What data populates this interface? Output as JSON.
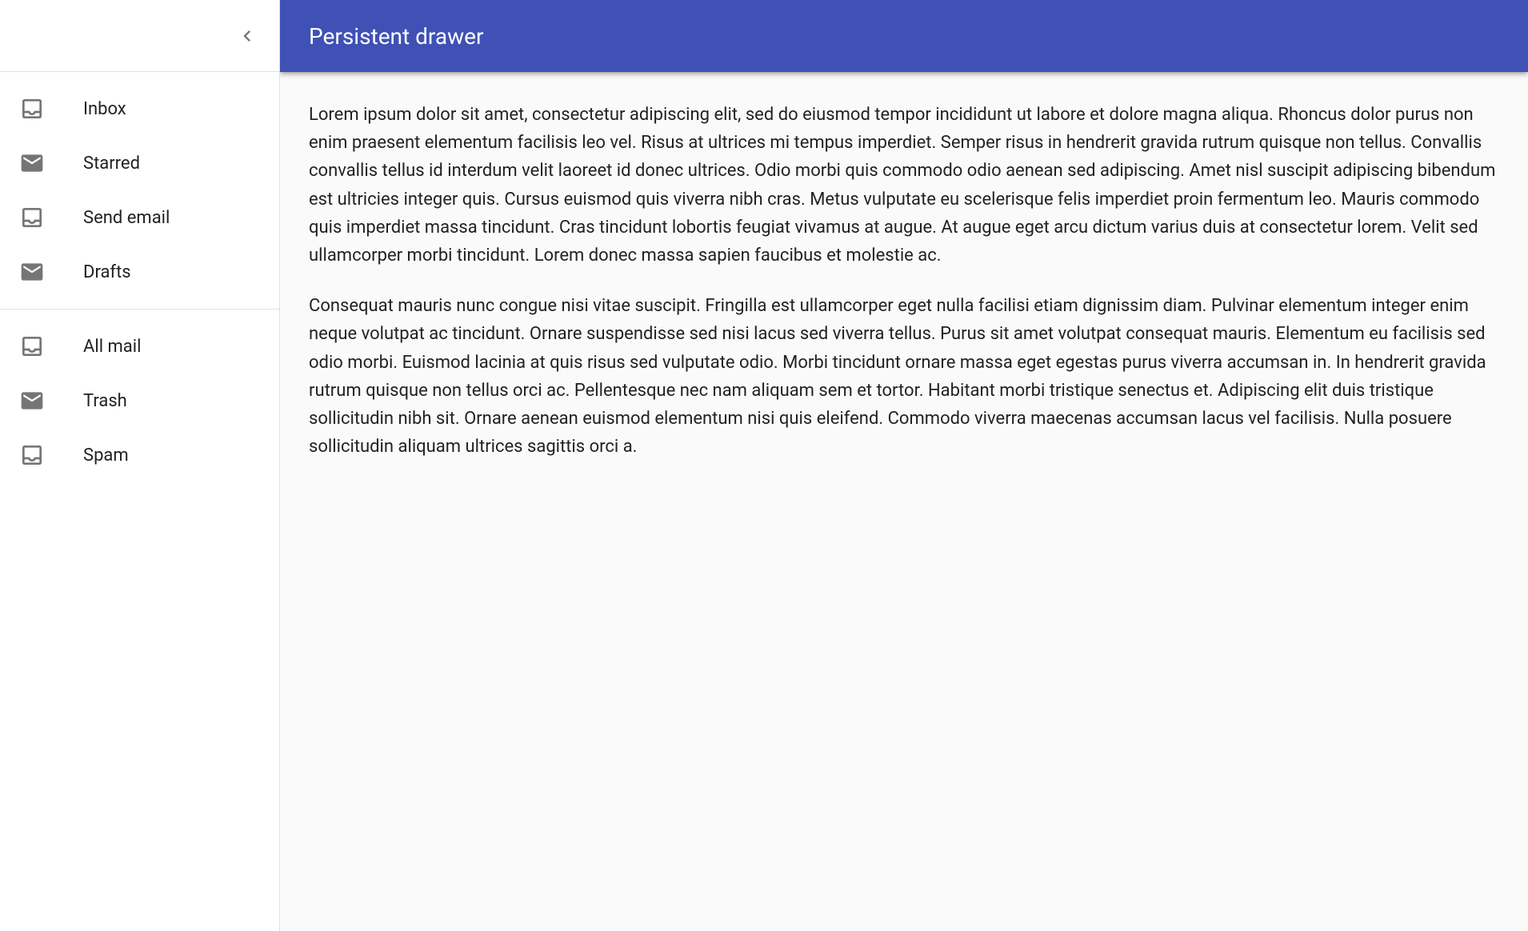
{
  "header": {
    "title": "Persistent drawer"
  },
  "drawer": {
    "primary_items": [
      {
        "icon": "inbox",
        "label": "Inbox"
      },
      {
        "icon": "mail",
        "label": "Starred"
      },
      {
        "icon": "inbox",
        "label": "Send email"
      },
      {
        "icon": "mail",
        "label": "Drafts"
      }
    ],
    "secondary_items": [
      {
        "icon": "inbox",
        "label": "All mail"
      },
      {
        "icon": "mail",
        "label": "Trash"
      },
      {
        "icon": "inbox",
        "label": "Spam"
      }
    ]
  },
  "content": {
    "paragraphs": [
      "Lorem ipsum dolor sit amet, consectetur adipiscing elit, sed do eiusmod tempor incididunt ut labore et dolore magna aliqua. Rhoncus dolor purus non enim praesent elementum facilisis leo vel. Risus at ultrices mi tempus imperdiet. Semper risus in hendrerit gravida rutrum quisque non tellus. Convallis convallis tellus id interdum velit laoreet id donec ultrices. Odio morbi quis commodo odio aenean sed adipiscing. Amet nisl suscipit adipiscing bibendum est ultricies integer quis. Cursus euismod quis viverra nibh cras. Metus vulputate eu scelerisque felis imperdiet proin fermentum leo. Mauris commodo quis imperdiet massa tincidunt. Cras tincidunt lobortis feugiat vivamus at augue. At augue eget arcu dictum varius duis at consectetur lorem. Velit sed ullamcorper morbi tincidunt. Lorem donec massa sapien faucibus et molestie ac.",
      "Consequat mauris nunc congue nisi vitae suscipit. Fringilla est ullamcorper eget nulla facilisi etiam dignissim diam. Pulvinar elementum integer enim neque volutpat ac tincidunt. Ornare suspendisse sed nisi lacus sed viverra tellus. Purus sit amet volutpat consequat mauris. Elementum eu facilisis sed odio morbi. Euismod lacinia at quis risus sed vulputate odio. Morbi tincidunt ornare massa eget egestas purus viverra accumsan in. In hendrerit gravida rutrum quisque non tellus orci ac. Pellentesque nec nam aliquam sem et tortor. Habitant morbi tristique senectus et. Adipiscing elit duis tristique sollicitudin nibh sit. Ornare aenean euismod elementum nisi quis eleifend. Commodo viverra maecenas accumsan lacus vel facilisis. Nulla posuere sollicitudin aliquam ultrices sagittis orci a."
    ]
  }
}
